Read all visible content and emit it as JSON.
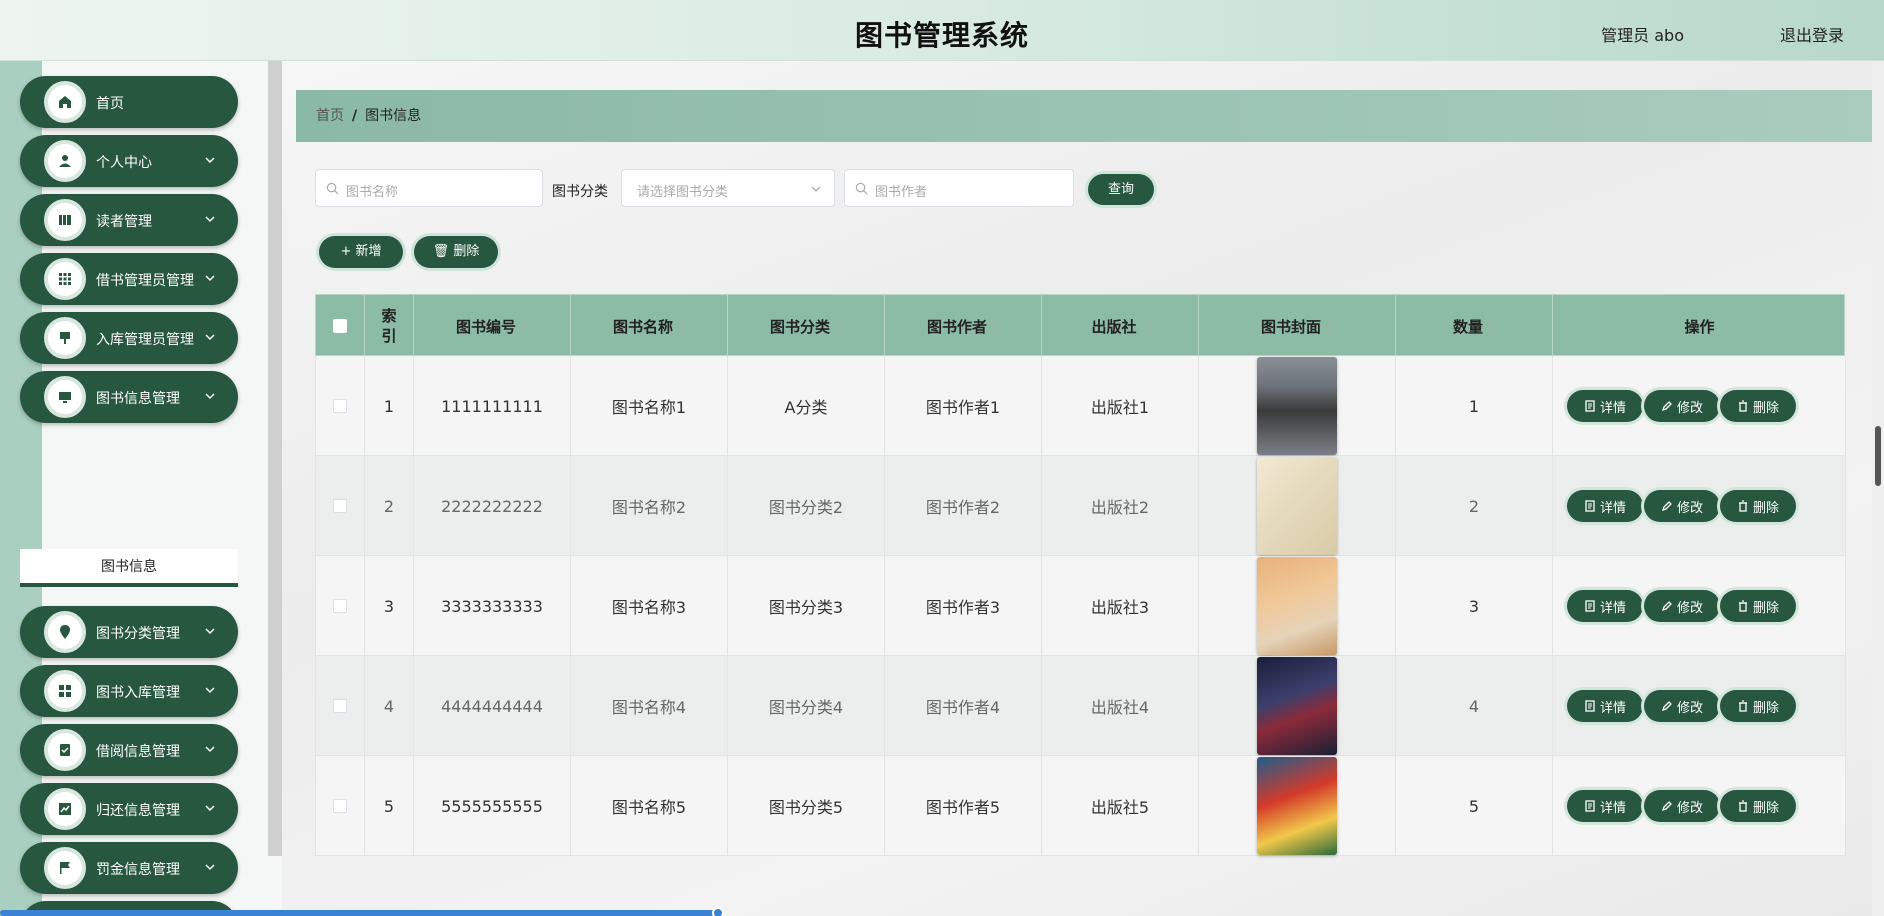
{
  "header": {
    "title": "图书管理系统",
    "user": "管理员 abo",
    "logout": "退出登录"
  },
  "sidebar": {
    "items": [
      {
        "label": "首页",
        "icon": "home-icon",
        "has_chevron": false
      },
      {
        "label": "个人中心",
        "icon": "user-icon",
        "has_chevron": true
      },
      {
        "label": "读者管理",
        "icon": "book-shelf-icon",
        "has_chevron": true
      },
      {
        "label": "借书管理员管理",
        "icon": "grid-dots-icon",
        "has_chevron": true
      },
      {
        "label": "入库管理员管理",
        "icon": "stamp-icon",
        "has_chevron": true
      },
      {
        "label": "图书信息管理",
        "icon": "monitor-icon",
        "has_chevron": true
      },
      {
        "label": "图书分类管理",
        "icon": "location-pin-icon",
        "has_chevron": true
      },
      {
        "label": "图书入库管理",
        "icon": "apps-icon",
        "has_chevron": true
      },
      {
        "label": "借阅信息管理",
        "icon": "clipboard-check-icon",
        "has_chevron": true
      },
      {
        "label": "归还信息管理",
        "icon": "trend-chart-icon",
        "has_chevron": true
      },
      {
        "label": "罚金信息管理",
        "icon": "flag-icon",
        "has_chevron": true
      }
    ],
    "sub_item": "图书信息"
  },
  "breadcrumb": {
    "home": "首页",
    "separator": "/",
    "current": "图书信息"
  },
  "filters": {
    "name_placeholder": "图书名称",
    "category_label": "图书分类",
    "category_placeholder": "请选择图书分类",
    "author_placeholder": "图书作者",
    "search_button": "查询"
  },
  "toolbar": {
    "add": "新增",
    "delete": "删除"
  },
  "table": {
    "columns": [
      "索引",
      "图书编号",
      "图书名称",
      "图书分类",
      "图书作者",
      "出版社",
      "图书封面",
      "数量",
      "操作"
    ],
    "rows": [
      {
        "index": "1",
        "code": "1111111111",
        "name": "图书名称1",
        "category": "A分类",
        "author": "图书作者1",
        "publisher": "出版社1",
        "qty": "1"
      },
      {
        "index": "2",
        "code": "2222222222",
        "name": "图书名称2",
        "category": "图书分类2",
        "author": "图书作者2",
        "publisher": "出版社2",
        "qty": "2"
      },
      {
        "index": "3",
        "code": "3333333333",
        "name": "图书名称3",
        "category": "图书分类3",
        "author": "图书作者3",
        "publisher": "出版社3",
        "qty": "3"
      },
      {
        "index": "4",
        "code": "4444444444",
        "name": "图书名称4",
        "category": "图书分类4",
        "author": "图书作者4",
        "publisher": "出版社4",
        "qty": "4"
      },
      {
        "index": "5",
        "code": "5555555555",
        "name": "图书名称5",
        "category": "图书分类5",
        "author": "图书作者5",
        "publisher": "出版社5",
        "qty": "5"
      }
    ],
    "actions": {
      "detail": "详情",
      "edit": "修改",
      "delete": "删除"
    }
  },
  "colors": {
    "primary": "#27573f",
    "header_row": "#8cbba6",
    "breadcrumb": "#8ab9a5"
  }
}
